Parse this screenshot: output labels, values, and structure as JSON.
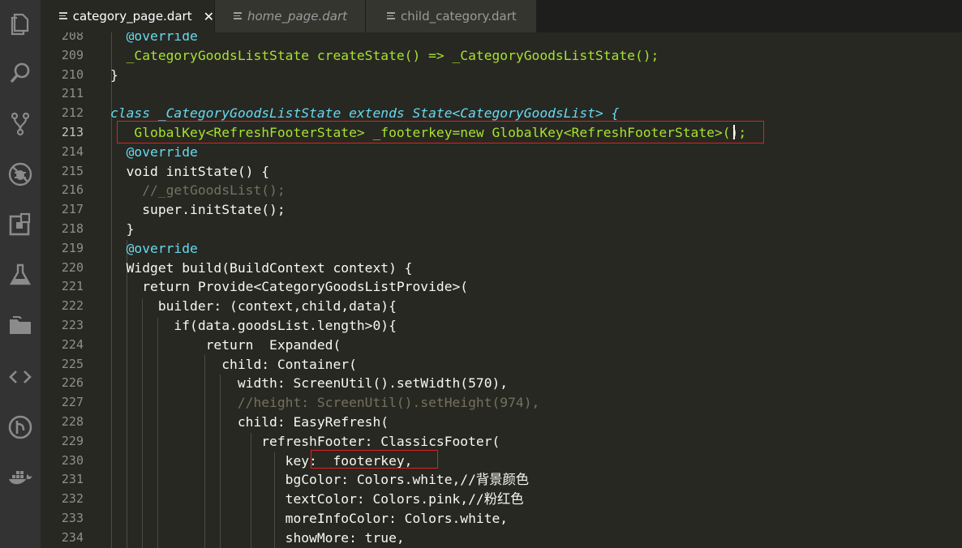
{
  "activity_bar": [
    {
      "icon": "explorer-icon"
    },
    {
      "icon": "search-icon"
    },
    {
      "icon": "source-control-icon"
    },
    {
      "icon": "debug-icon"
    },
    {
      "icon": "extensions-icon"
    },
    {
      "icon": "test-flask-icon"
    },
    {
      "icon": "folder-icon"
    },
    {
      "icon": "code-brackets-icon"
    },
    {
      "icon": "git-graph-icon"
    },
    {
      "icon": "docker-icon"
    }
  ],
  "tabs": [
    {
      "label": "category_page.dart",
      "active": true,
      "close": "✕"
    },
    {
      "label": "home_page.dart",
      "active": false
    },
    {
      "label": "child_category.dart",
      "active": false
    }
  ],
  "editor": {
    "current_line": "213",
    "lines": [
      {
        "n": "208"
      },
      {
        "n": "209"
      },
      {
        "n": "210"
      },
      {
        "n": "211"
      },
      {
        "n": "212"
      },
      {
        "n": "213"
      },
      {
        "n": "214"
      },
      {
        "n": "215"
      },
      {
        "n": "216"
      },
      {
        "n": "217"
      },
      {
        "n": "218"
      },
      {
        "n": "219"
      },
      {
        "n": "220"
      },
      {
        "n": "221"
      },
      {
        "n": "222"
      },
      {
        "n": "223"
      },
      {
        "n": "224"
      },
      {
        "n": "225"
      },
      {
        "n": "226"
      },
      {
        "n": "227"
      },
      {
        "n": "228"
      },
      {
        "n": "229"
      },
      {
        "n": "230"
      },
      {
        "n": "231"
      },
      {
        "n": "232"
      },
      {
        "n": "233"
      },
      {
        "n": "234"
      }
    ],
    "code": [
      "  @override",
      "  _CategoryGoodsListState createState() => _CategoryGoodsListState();",
      "}",
      "",
      "class _CategoryGoodsListState extends State<CategoryGoodsList> {",
      "   GlobalKey<RefreshFooterState> _footerkey=new GlobalKey<RefreshFooterState>();",
      "  @override",
      "  void initState() {",
      "    //_getGoodsList();",
      "    super.initState();",
      "  }",
      "  @override",
      "  Widget build(BuildContext context) {",
      "    return Provide<CategoryGoodsListProvide>(",
      "      builder: (context,child,data){",
      "        if(data.goodsList.length>0){",
      "            return  Expanded(",
      "              child: Container(",
      "                width: ScreenUtil().setWidth(570),",
      "                //height: ScreenUtil().setHeight(974),",
      "                child: EasyRefresh(",
      "                   refreshFooter: ClassicsFooter(",
      "                      key: _footerkey,",
      "                      bgColor: Colors.white,//背景颜色",
      "                      textColor: Colors.pink,//粉红色",
      "                      moreInfoColor: Colors.white,",
      "                      showMore: true,"
    ]
  }
}
